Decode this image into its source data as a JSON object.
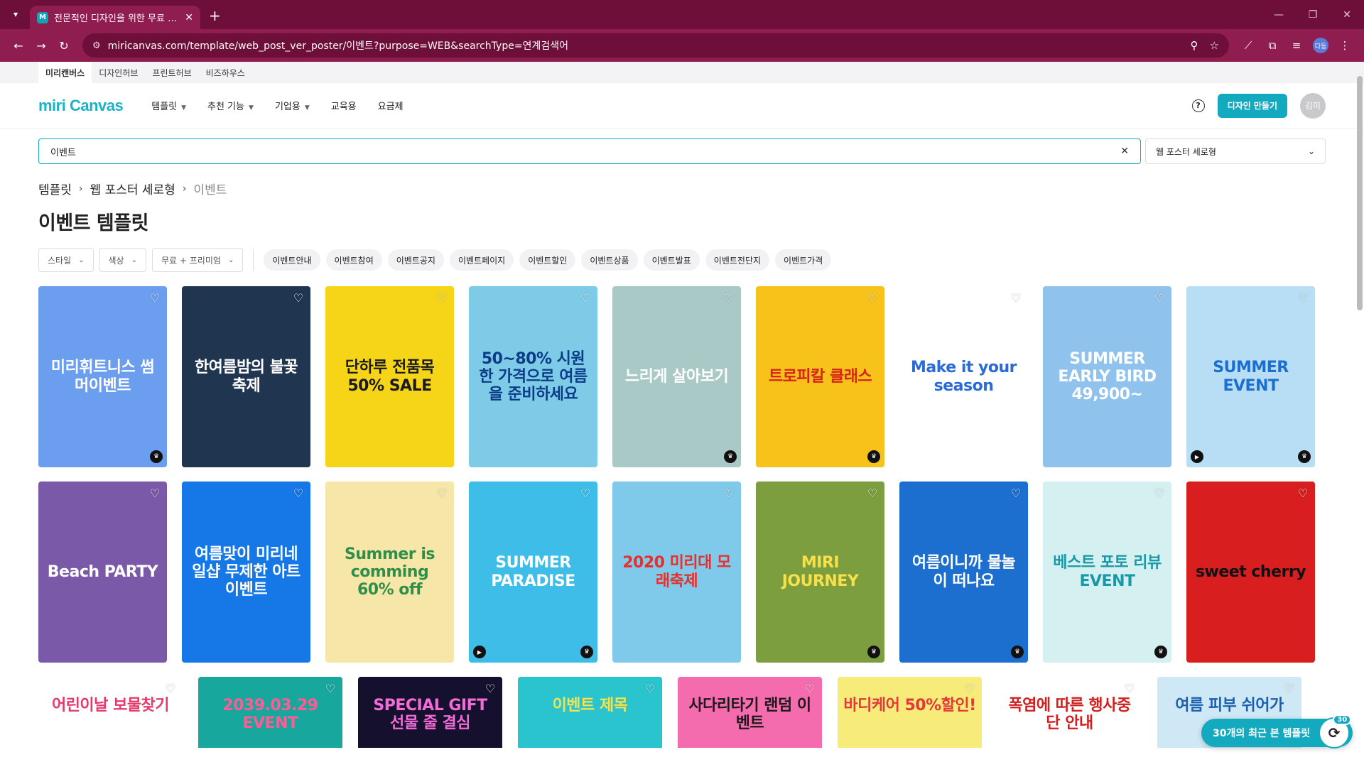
{
  "browser": {
    "tab_title": "전문적인 디자인을 위한 무료 디자인",
    "url": "miricanvas.com/template/web_post_ver_poster/이벤트?purpose=WEB&searchType=연계검색어",
    "profile": "다동"
  },
  "site_strip": [
    "미리캔버스",
    "디자인허브",
    "프린트허브",
    "비즈하우스"
  ],
  "header": {
    "logo": "miri Canvas",
    "nav": [
      "템플릿",
      "추천 기능",
      "기업용",
      "교육용",
      "요금제"
    ],
    "cta": "디자인 만들기",
    "avatar": "김미"
  },
  "search": {
    "value": "이벤트",
    "type_label": "웹 포스터 세로형"
  },
  "breadcrumb": [
    "템플릿",
    "웹 포스터 세로형",
    "이벤트"
  ],
  "page_title": "이벤트 템플릿",
  "filters": {
    "dropdowns": [
      "스타일",
      "색상",
      "무료 + 프리미엄"
    ],
    "chips": [
      "이벤트안내",
      "이벤트참여",
      "이벤트공지",
      "이벤트페이지",
      "이벤트할인",
      "이벤트상품",
      "이벤트발표",
      "이벤트전단지",
      "이벤트가격"
    ]
  },
  "templates_row1": [
    {
      "title": "미리휘트니스 썸머이벤트",
      "bg": "#6c9ef0",
      "fg": "#ffffff",
      "crown": true,
      "play": false
    },
    {
      "title": "한여름밤의 불꽃축제",
      "bg": "#1f3550",
      "fg": "#ffffff",
      "crown": false,
      "play": false
    },
    {
      "title": "단하루 전품목 50% SALE",
      "bg": "#f6d417",
      "fg": "#1a1a1a",
      "crown": false,
      "play": false
    },
    {
      "title": "50~80% 시원한 가격으로 여름을 준비하세요",
      "bg": "#7ecbe8",
      "fg": "#0b3c87",
      "crown": false,
      "play": false
    },
    {
      "title": "느리게 살아보기",
      "bg": "#a9c9c6",
      "fg": "#ffffff",
      "crown": true,
      "play": false
    },
    {
      "title": "트로피칼 클래스",
      "bg": "#f7c21a",
      "fg": "#d8231b",
      "crown": true,
      "play": false
    },
    {
      "title": "Make it your season",
      "bg": "#ffffff",
      "fg": "#2c6ad8",
      "crown": false,
      "play": false
    },
    {
      "title": "SUMMER EARLY BIRD 49,900~",
      "bg": "#8fc3ee",
      "fg": "#ffffff",
      "crown": false,
      "play": false
    },
    {
      "title": "SUMMER EVENT",
      "bg": "#b7def4",
      "fg": "#1b6fd0",
      "crown": true,
      "play": true
    }
  ],
  "templates_row2": [
    {
      "title": "Beach PARTY",
      "bg": "#7a5aa8",
      "fg": "#ffffff",
      "crown": false,
      "play": false
    },
    {
      "title": "여름맞이 미리네일샵 무제한 아트 이벤트",
      "bg": "#1677e6",
      "fg": "#ffffff",
      "crown": false,
      "play": false
    },
    {
      "title": "Summer is comming 60% off",
      "bg": "#f6e6a8",
      "fg": "#2f8f4a",
      "crown": false,
      "play": false
    },
    {
      "title": "SUMMER PARADISE",
      "bg": "#3dbde8",
      "fg": "#ffffff",
      "crown": true,
      "play": true
    },
    {
      "title": "2020 미리대 모래축제",
      "bg": "#7fc9ea",
      "fg": "#e8302b",
      "crown": false,
      "play": false
    },
    {
      "title": "MIRI JOURNEY",
      "bg": "#7c9e3e",
      "fg": "#f7e04a",
      "crown": true,
      "play": false
    },
    {
      "title": "여름이니까 물놀이 떠나요",
      "bg": "#1c6fcf",
      "fg": "#ffffff",
      "crown": true,
      "play": false
    },
    {
      "title": "베스트 포토 리뷰 EVENT",
      "bg": "#d4f0f1",
      "fg": "#1a98a8",
      "crown": true,
      "play": false
    },
    {
      "title": "sweet cherry",
      "bg": "#d81e1e",
      "fg": "#111111",
      "crown": false,
      "play": false
    }
  ],
  "templates_row3": [
    {
      "title": "어린이날 보물찾기",
      "bg": "#ffffff",
      "fg": "#e23a6b"
    },
    {
      "title": "2039.03.29 EVENT",
      "bg": "#18a79c",
      "fg": "#ff5b95"
    },
    {
      "title": "SPECIAL GIFT 선물 줄 결심",
      "bg": "#14102e",
      "fg": "#f36bd6"
    },
    {
      "title": "이벤트 제목",
      "bg": "#2ac4cf",
      "fg": "#f7e24a"
    },
    {
      "title": "사다리타기 랜덤 이벤트",
      "bg": "#f56cae",
      "fg": "#1a1a1a"
    },
    {
      "title": "바디케어 50%할인!",
      "bg": "#f7ec7a",
      "fg": "#e23a3a"
    },
    {
      "title": "폭염에 따른 행사중단 안내",
      "bg": "#ffffff",
      "fg": "#d11f1f"
    },
    {
      "title": "여름 피부 쉬어가",
      "bg": "#cfe8f5",
      "fg": "#1b5fb0"
    }
  ],
  "recent": {
    "label": "30개의 최근 본 템플릿",
    "count": "30"
  }
}
